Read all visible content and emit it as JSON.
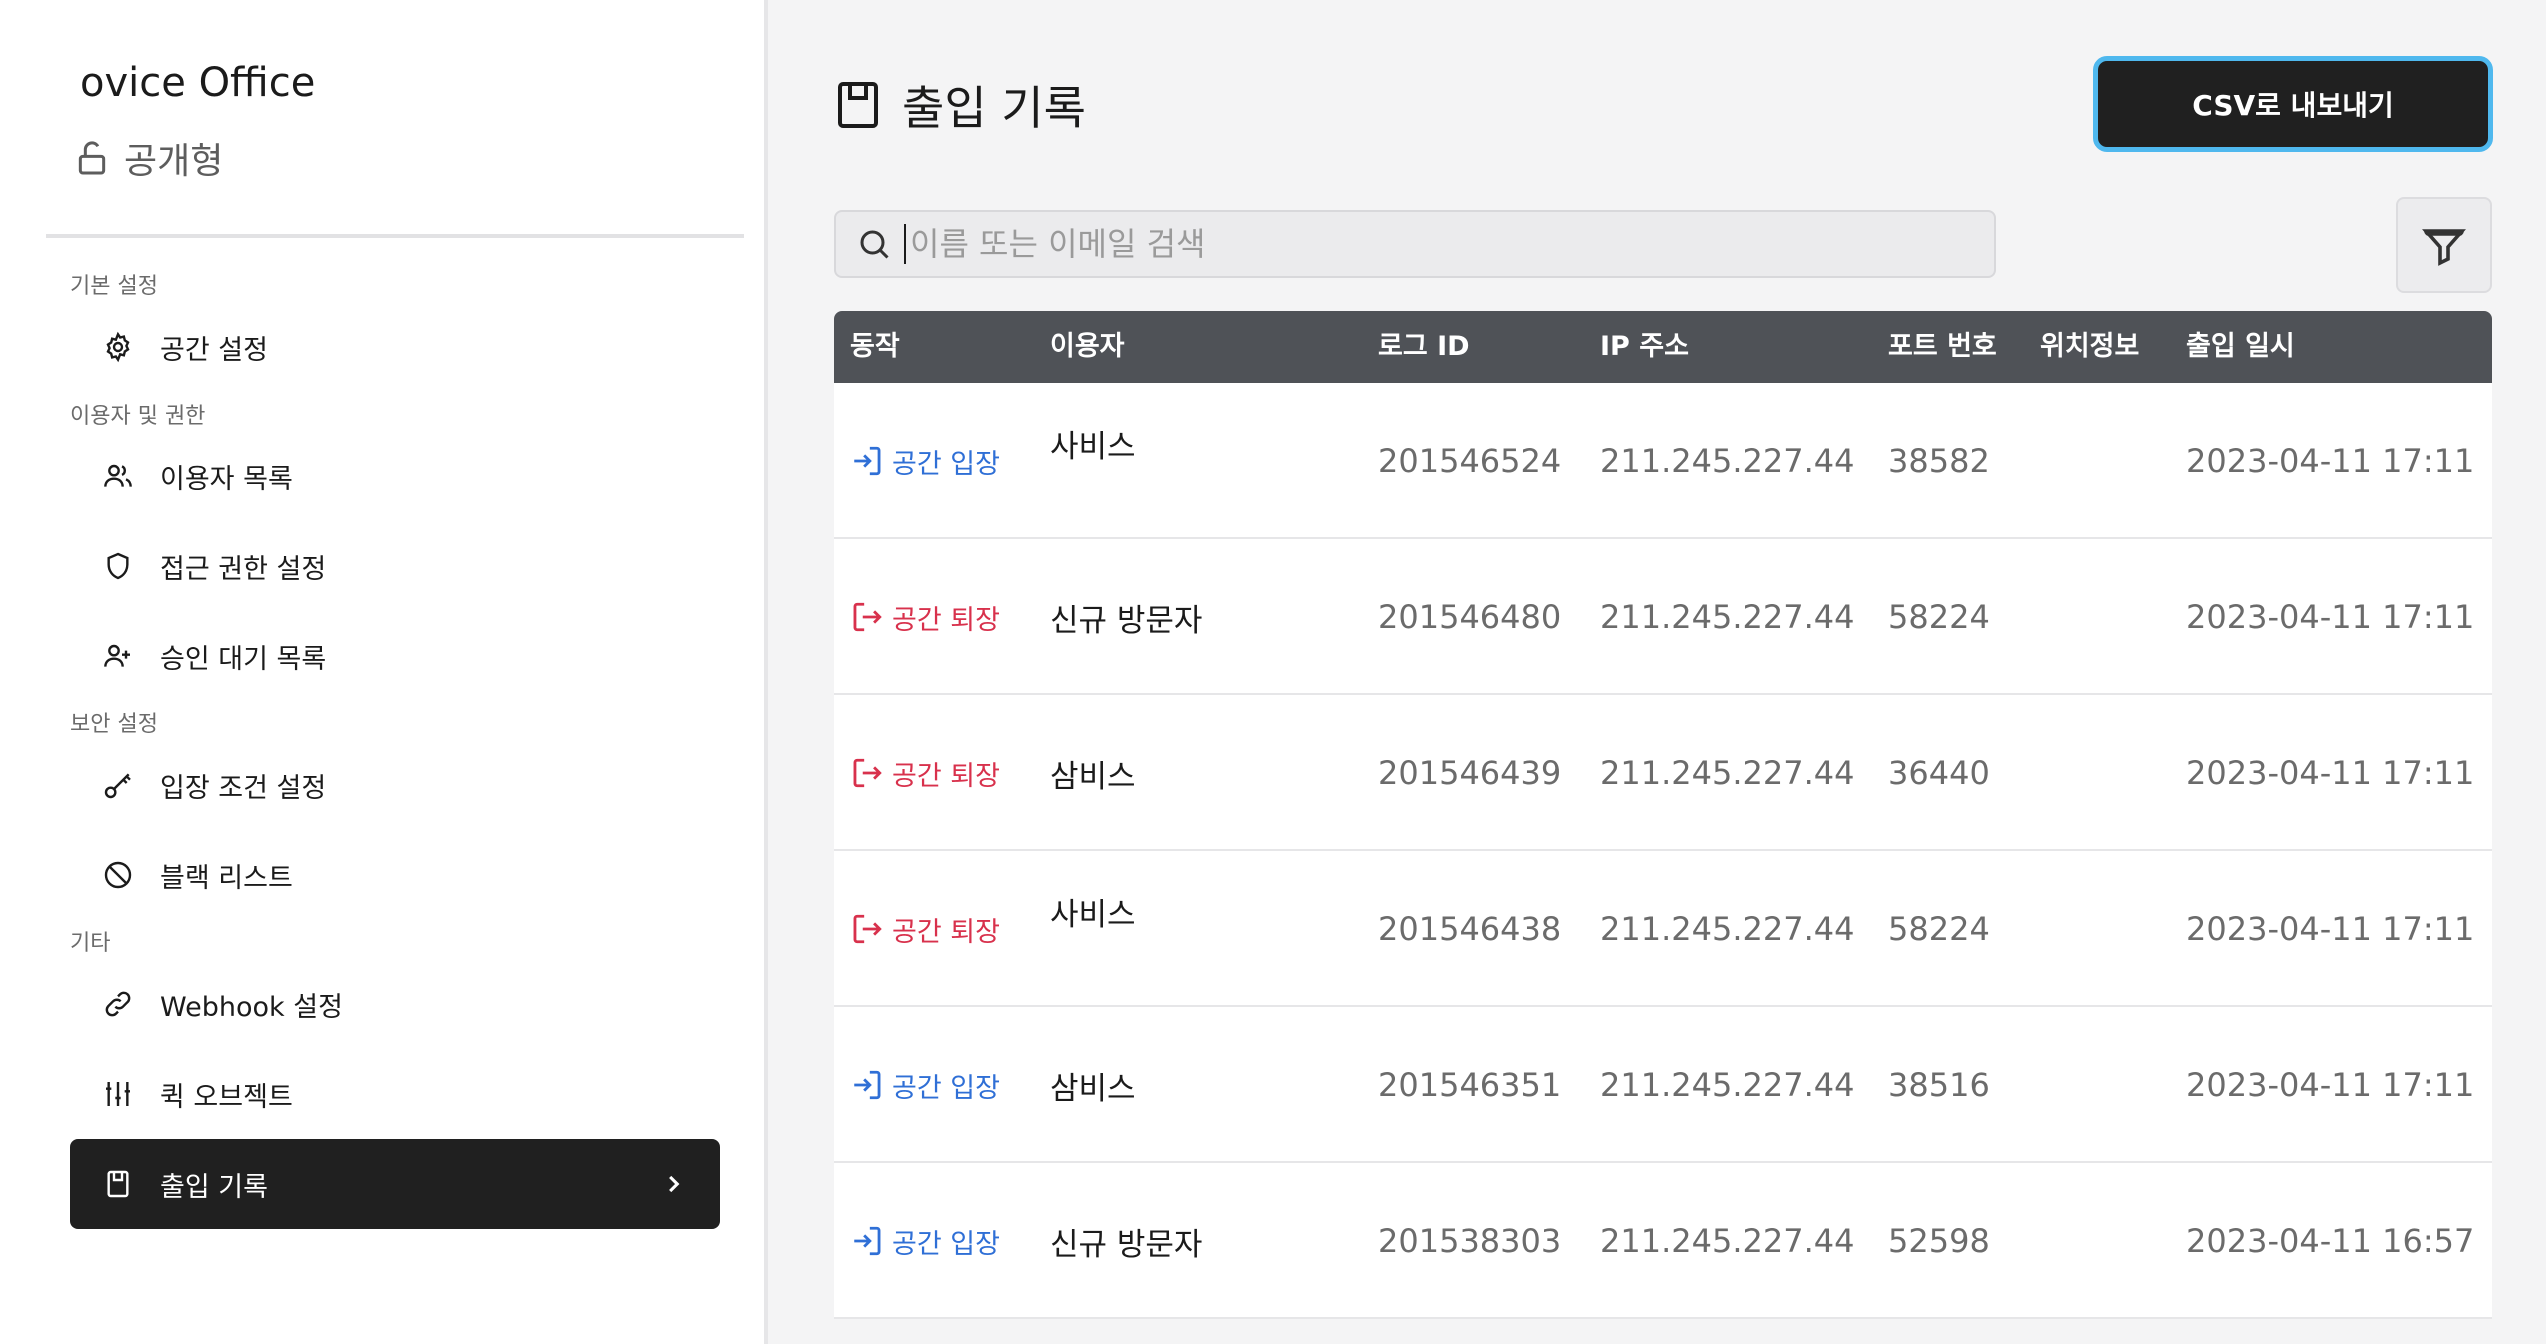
{
  "sidebar": {
    "brand": "ovice Office",
    "visibility": "공개형",
    "sections": {
      "basic": "기본 설정",
      "users": "이용자 및 권한",
      "security": "보안 설정",
      "etc": "기타"
    },
    "items": {
      "space_settings": "공간 설정",
      "user_list": "이용자 목록",
      "access_permission": "접근 권한 설정",
      "approval_waiting": "승인 대기 목록",
      "entry_conditions": "입장 조건 설정",
      "blacklist": "블랙 리스트",
      "webhook": "Webhook 설정",
      "quick_object": "퀵 오브젝트",
      "access_log": "출입 기록"
    }
  },
  "main": {
    "title": "출입 기록",
    "csv_button": "CSV로 내보내기",
    "search_placeholder": "이름 또는 이메일 검색",
    "columns": {
      "action": "동작",
      "user": "이용자",
      "log_id": "로그 ID",
      "ip": "IP 주소",
      "port": "포트 번호",
      "location": "위치정보",
      "time": "출입 일시"
    },
    "rows": [
      {
        "action": "공간 입장",
        "type": "enter",
        "user": "사비스",
        "log_id": "201546524",
        "ip": "211.245.227.44",
        "port": "38582",
        "time": "2023-04-11 17:11"
      },
      {
        "action": "공간 퇴장",
        "type": "exit",
        "user": "신규 방문자",
        "log_id": "201546480",
        "ip": "211.245.227.44",
        "port": "58224",
        "time": "2023-04-11 17:11"
      },
      {
        "action": "공간 퇴장",
        "type": "exit",
        "user": "삼비스",
        "log_id": "201546439",
        "ip": "211.245.227.44",
        "port": "36440",
        "time": "2023-04-11 17:11"
      },
      {
        "action": "공간 퇴장",
        "type": "exit",
        "user": "사비스",
        "log_id": "201546438",
        "ip": "211.245.227.44",
        "port": "58224",
        "time": "2023-04-11 17:11"
      },
      {
        "action": "공간 입장",
        "type": "enter",
        "user": "삼비스",
        "log_id": "201546351",
        "ip": "211.245.227.44",
        "port": "38516",
        "time": "2023-04-11 17:11"
      },
      {
        "action": "공간 입장",
        "type": "enter",
        "user": "신규 방문자",
        "log_id": "201538303",
        "ip": "211.245.227.44",
        "port": "52598",
        "time": "2023-04-11 16:57"
      }
    ]
  },
  "colors": {
    "enter": "#2f6fd6",
    "exit": "#d8314c",
    "accent_border": "#4fb8ee",
    "header_bg": "#4f5257"
  }
}
